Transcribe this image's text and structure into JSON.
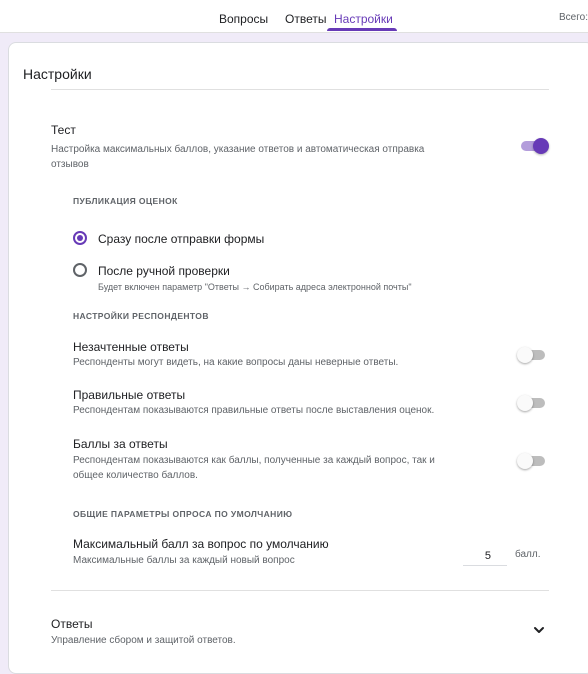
{
  "tabs": {
    "questions": "Вопросы",
    "answers": "Ответы",
    "settings": "Настройки"
  },
  "header": {
    "total": "Всего:"
  },
  "settings": {
    "title": "Настройки",
    "quiz": {
      "title": "Тест",
      "description_line1": "Настройка максимальных баллов, указание ответов и автоматическая отправка",
      "description_line2": "отзывов",
      "enabled": true
    },
    "grade_release": {
      "section_label": "ПУБЛИКАЦИЯ ОЦЕНОК",
      "options": [
        {
          "label": "Сразу после отправки формы",
          "selected": true
        },
        {
          "label": "После ручной проверки",
          "hint": "Будет включен параметр \"Ответы → Собирать адреса электронной почты\"",
          "selected": false
        }
      ]
    },
    "respondent_settings": {
      "section_label": "НАСТРОЙКИ РЕСПОНДЕНТОВ",
      "items": [
        {
          "title": "Незачтенные ответы",
          "description": "Респонденты могут видеть, на какие вопросы даны неверные ответы.",
          "enabled": false
        },
        {
          "title": "Правильные ответы",
          "description": "Респондентам показываются правильные ответы после выставления оценок.",
          "enabled": false
        },
        {
          "title": "Баллы за ответы",
          "description_line1": "Респондентам показываются как баллы, полученные за каждый вопрос, так и",
          "description_line2": "общее количество баллов.",
          "enabled": false
        }
      ]
    },
    "defaults": {
      "section_label": "ОБЩИЕ ПАРАМЕТРЫ ОПРОСА ПО УМОЛЧАНИЮ",
      "max_points_title": "Максимальный балл за вопрос по умолчанию",
      "max_points_description": "Максимальные баллы за каждый новый вопрос",
      "max_points_value": "5",
      "unit": "балл."
    },
    "responses": {
      "title": "Ответы",
      "description": "Управление сбором и защитой ответов."
    }
  },
  "colors": {
    "accent": "#673ab7",
    "background": "#f0ebf8"
  },
  "icons": {
    "expand": "chevron-down-icon"
  }
}
